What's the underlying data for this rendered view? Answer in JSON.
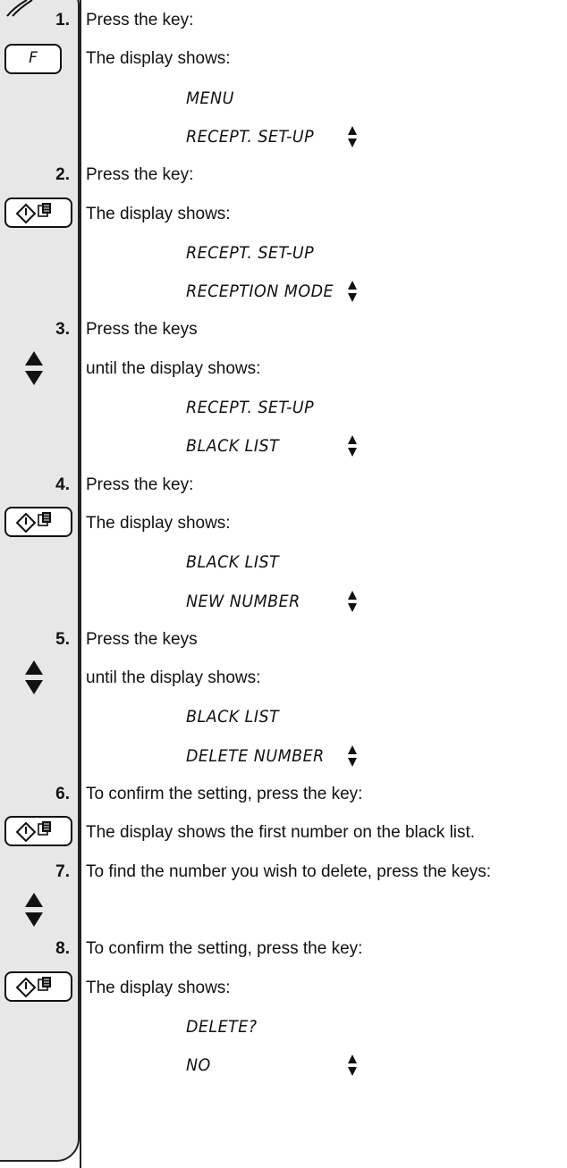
{
  "steps": [
    {
      "n": "1.",
      "lines": [
        {
          "t": "text",
          "v": "Press the key:"
        },
        {
          "t": "text",
          "v": "The display shows:",
          "key": "f",
          "key_label": "F"
        },
        {
          "t": "disp",
          "v": "MENU"
        },
        {
          "t": "disp",
          "v": "RECEPT. SET-UP",
          "arrows": true
        }
      ]
    },
    {
      "n": "2.",
      "lines": [
        {
          "t": "text",
          "v": "Press the key:"
        },
        {
          "t": "text",
          "v": "The display shows:",
          "key": "start"
        },
        {
          "t": "disp",
          "v": "RECEPT. SET-UP"
        },
        {
          "t": "disp",
          "v": "RECEPTION MODE",
          "arrows": true
        }
      ]
    },
    {
      "n": "3.",
      "lines": [
        {
          "t": "text",
          "v": "Press the keys"
        },
        {
          "t": "text",
          "v": "until the display shows:",
          "key": "arrows"
        },
        {
          "t": "disp",
          "v": "RECEPT. SET-UP"
        },
        {
          "t": "disp",
          "v": "BLACK LIST",
          "arrows": true
        }
      ]
    },
    {
      "n": "4.",
      "lines": [
        {
          "t": "text",
          "v": "Press the key:"
        },
        {
          "t": "text",
          "v": "The display shows:",
          "key": "start"
        },
        {
          "t": "disp",
          "v": "BLACK LIST"
        },
        {
          "t": "disp",
          "v": "NEW NUMBER",
          "arrows": true
        }
      ]
    },
    {
      "n": "5.",
      "lines": [
        {
          "t": "text",
          "v": "Press the keys"
        },
        {
          "t": "text",
          "v": "until the display shows:",
          "key": "arrows"
        },
        {
          "t": "disp",
          "v": "BLACK LIST"
        },
        {
          "t": "disp",
          "v": "DELETE NUMBER",
          "arrows": true
        }
      ]
    },
    {
      "n": "6.",
      "lines": [
        {
          "t": "text",
          "v": "To confirm the setting, press the key:"
        },
        {
          "t": "text",
          "v": "The display shows the first number on the black list.",
          "key": "start"
        }
      ]
    },
    {
      "n": "7.",
      "lines": [
        {
          "t": "text",
          "v": "To find the number you wish to delete, press the keys:"
        },
        {
          "t": "text",
          "v": "",
          "key": "arrows"
        }
      ]
    },
    {
      "n": "8.",
      "lines": [
        {
          "t": "text",
          "v": "To confirm the setting, press the key:"
        },
        {
          "t": "text",
          "v": "The display shows:",
          "key": "start"
        },
        {
          "t": "disp",
          "v": "DELETE?"
        },
        {
          "t": "disp",
          "v": "NO",
          "arrows": true
        }
      ]
    }
  ],
  "colors": {
    "gutter": "#e7e7e7",
    "ink": "#111111"
  },
  "icons": {
    "f": "f-key-icon",
    "start": "start-copy-key-icon",
    "arrows": "up-down-arrow-keys-icon",
    "pen": "note-pen-icon"
  }
}
